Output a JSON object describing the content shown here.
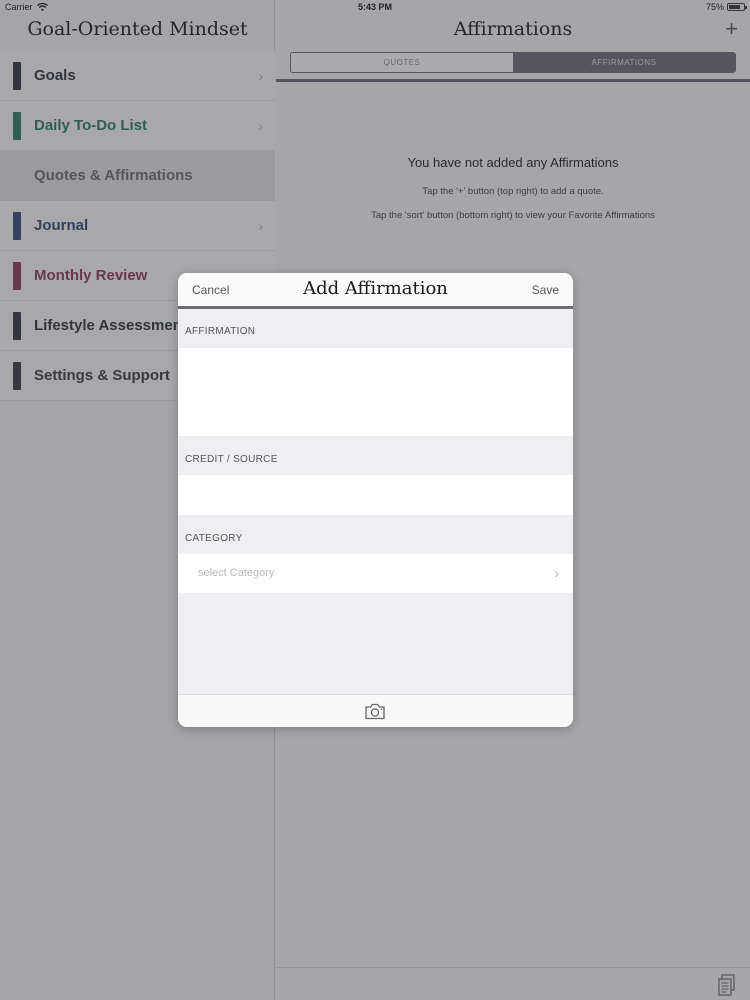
{
  "status_bar": {
    "carrier": "Carrier",
    "time": "5:43 PM",
    "battery": "75%",
    "battery_level": 0.75
  },
  "sidebar": {
    "title": "Goal-Oriented Mindset",
    "items": [
      {
        "label": "Goals",
        "color": "#2f3540",
        "chevron": "›",
        "selected": false
      },
      {
        "label": "Daily To-Do List",
        "color": "#2e7a63",
        "chevron": "›",
        "selected": false
      },
      {
        "label": "Quotes & Affirmations",
        "color": "#6b6b75",
        "chevron": "",
        "selected": true
      },
      {
        "label": "Journal",
        "color": "#34487a",
        "chevron": "›",
        "selected": false
      },
      {
        "label": "Monthly Review",
        "color": "#8a3b55",
        "chevron": "›",
        "selected": false
      },
      {
        "label": "Lifestyle Assessment",
        "color": "#2f3540",
        "chevron": "",
        "selected": false
      },
      {
        "label": "Settings & Support",
        "color": "#3b3d45",
        "chevron": "",
        "selected": false
      }
    ]
  },
  "main": {
    "title": "Affirmations",
    "plus_label": "+",
    "tabs": [
      {
        "label": "QUOTES",
        "active": false
      },
      {
        "label": "AFFIRMATIONS",
        "active": true
      }
    ],
    "empty_title": "You have not added any Affirmations",
    "empty_line_1": "Tap the '+' button (top right) to add a quote.",
    "empty_line_2": "Tap the 'sort' button (bottom right) to view your Favorite Affirmations"
  },
  "modal": {
    "cancel_label": "Cancel",
    "title": "Add Affirmation",
    "save_label": "Save",
    "affirmation_label": "AFFIRMATION",
    "affirmation_value": "",
    "credit_label": "CREDIT / SOURCE",
    "credit_value": "",
    "category_label": "CATEGORY",
    "category_placeholder": "select Category",
    "category_chevron": "›"
  },
  "colors": {
    "accent": "#6d6a74"
  },
  "icons": {
    "wifi": "wifi-icon",
    "battery": "battery-icon",
    "plus": "plus-icon",
    "camera": "camera-icon",
    "sort": "sort-icon",
    "chevron": "chevron-right-icon"
  }
}
